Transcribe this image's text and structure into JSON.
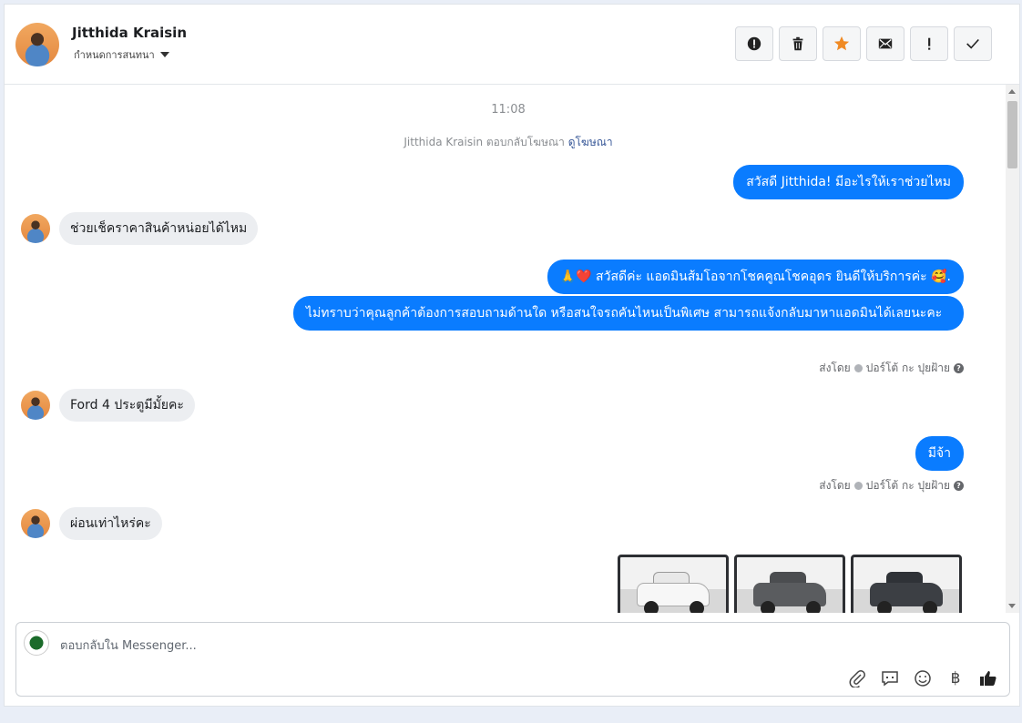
{
  "header": {
    "name": "Jitthida Kraisin",
    "assign_label": "กำหนดการสนทนา",
    "actions": [
      "report-icon",
      "delete-icon",
      "star-icon",
      "mail-icon",
      "important-icon",
      "done-icon"
    ]
  },
  "chat": {
    "timestamp": "11:08",
    "notice_prefix": "Jitthida Kraisin ตอบกลับโฆษณา",
    "notice_link": "ดูโฆษณา",
    "messages": [
      {
        "dir": "out",
        "text": "สวัสดี Jitthida! มีอะไรให้เราช่วยไหม"
      },
      {
        "dir": "in",
        "text": "ช่วยเช็คราคาสินค้าหน่อยได้ไหม"
      },
      {
        "dir": "out",
        "text": "🙏❤️ สวัสดีค่ะ แอดมินส้มโอจากโชคคูณโชคอุดร ยินดีให้บริการค่ะ 🥰."
      },
      {
        "dir": "out",
        "text": "ไม่ทราบว่าคุณลูกค้าต้องการสอบถามด้านใด หรือสนใจรถคันไหนเป็นพิเศษ สามารถแจ้งกลับมาหาแอดมินได้เลยนะคะ"
      },
      {
        "dir": "in",
        "text": "Ford 4 ประตูมีมั้ยคะ"
      },
      {
        "dir": "out",
        "text": "มีจ้า"
      },
      {
        "dir": "in",
        "text": "ผ่อนเท่าไหร่คะ"
      }
    ],
    "sent_by_label": "ส่งโดย",
    "sent_by_name": "ปอร์โต้ กะ ปุยฝ้าย",
    "cars": [
      {
        "color": "#f4f4f4",
        "name": "white-pickup"
      },
      {
        "color": "#5a5c5f",
        "name": "grey-pickup"
      },
      {
        "color": "#3c3f44",
        "name": "dark-pickup"
      }
    ]
  },
  "composer": {
    "placeholder": "ตอบกลับใน Messenger...",
    "tools": [
      "attach-icon",
      "saved-reply-icon",
      "emoji-icon",
      "baht-icon",
      "like-icon"
    ],
    "baht_symbol": "฿"
  },
  "colors": {
    "accent": "#0a7cff",
    "incoming": "#eceef1"
  }
}
